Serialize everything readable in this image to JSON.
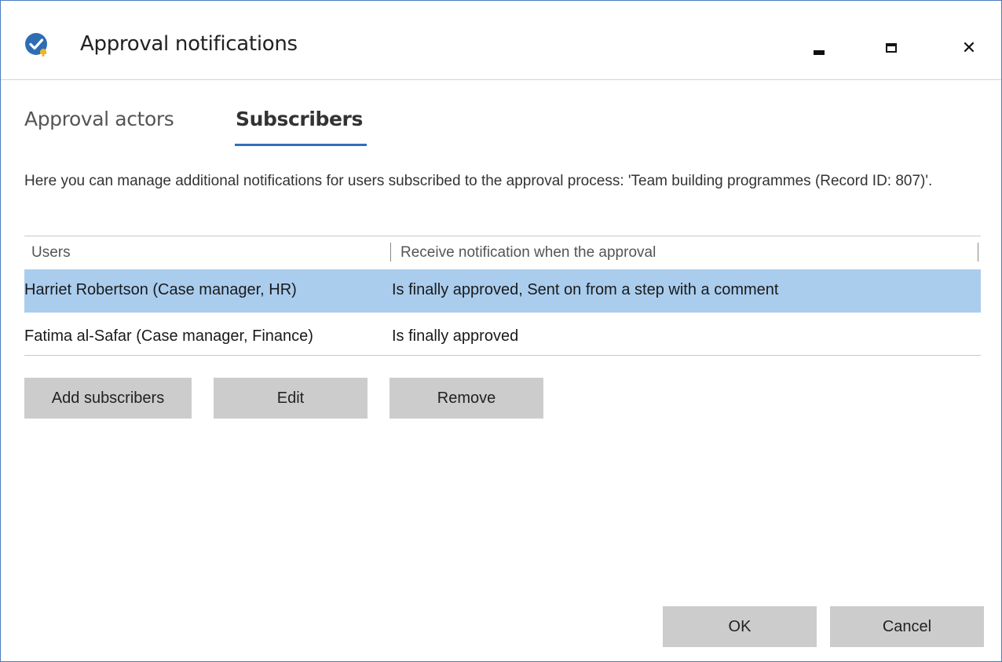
{
  "window": {
    "title": "Approval notifications",
    "icon": "checkmark-badge-icon",
    "controls": {
      "minimize": "minimize-icon",
      "maximize": "maximize-icon",
      "close_label": "✕"
    }
  },
  "tabs": [
    {
      "label": "Approval actors",
      "active": false
    },
    {
      "label": "Subscribers",
      "active": true
    }
  ],
  "description": "Here you can manage additional notifications for users subscribed to the approval process: 'Team building programmes (Record ID: 807)'.",
  "table": {
    "columns": [
      "Users",
      "Receive notification when the approval"
    ],
    "rows": [
      {
        "user": "Harriet Robertson (Case manager, HR)",
        "notify": "Is finally approved, Sent on from a step with a comment",
        "selected": true
      },
      {
        "user": "Fatima al-Safar (Case manager, Finance)",
        "notify": "Is finally approved",
        "selected": false
      }
    ]
  },
  "actions": {
    "add": "Add subscribers",
    "edit": "Edit",
    "remove": "Remove"
  },
  "footer": {
    "ok": "OK",
    "cancel": "Cancel"
  },
  "colors": {
    "accent": "#2f6fbf",
    "selection": "#aacdee",
    "button": "#cccccc",
    "window_border": "#4a7fc1"
  }
}
